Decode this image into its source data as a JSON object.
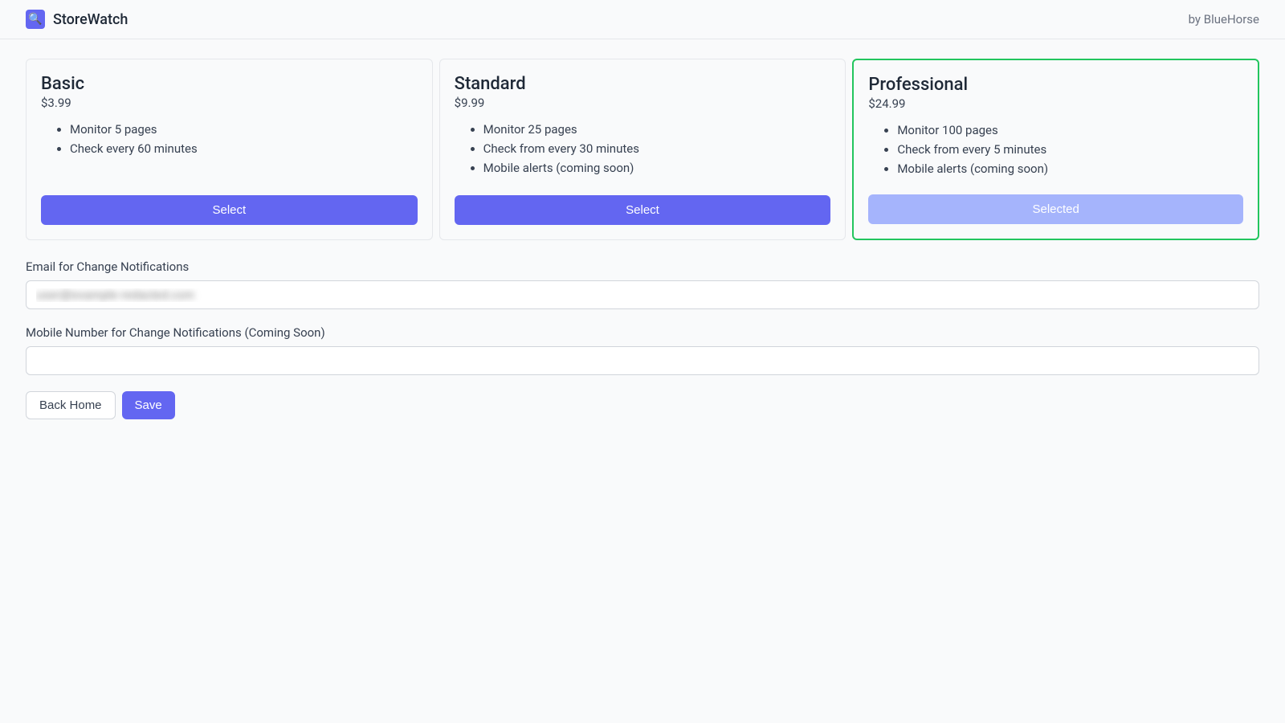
{
  "header": {
    "brand_name": "StoreWatch",
    "brand_emoji": "🔍",
    "attribution": "by BlueHorse"
  },
  "plans": [
    {
      "name": "Basic",
      "price": "$3.99",
      "features": [
        "Monitor 5 pages",
        "Check every 60 minutes"
      ],
      "button_label": "Select",
      "selected": false
    },
    {
      "name": "Standard",
      "price": "$9.99",
      "features": [
        "Monitor 25 pages",
        "Check from every 30 minutes",
        "Mobile alerts (coming soon)"
      ],
      "button_label": "Select",
      "selected": false
    },
    {
      "name": "Professional",
      "price": "$24.99",
      "features": [
        "Monitor 100 pages",
        "Check from every 5 minutes",
        "Mobile alerts (coming soon)"
      ],
      "button_label": "Selected",
      "selected": true
    }
  ],
  "form": {
    "email_label": "Email for Change Notifications",
    "email_value": "user@example-redacted.com",
    "mobile_label": "Mobile Number for Change Notifications (Coming Soon)",
    "mobile_value": ""
  },
  "actions": {
    "back_label": "Back Home",
    "save_label": "Save"
  }
}
